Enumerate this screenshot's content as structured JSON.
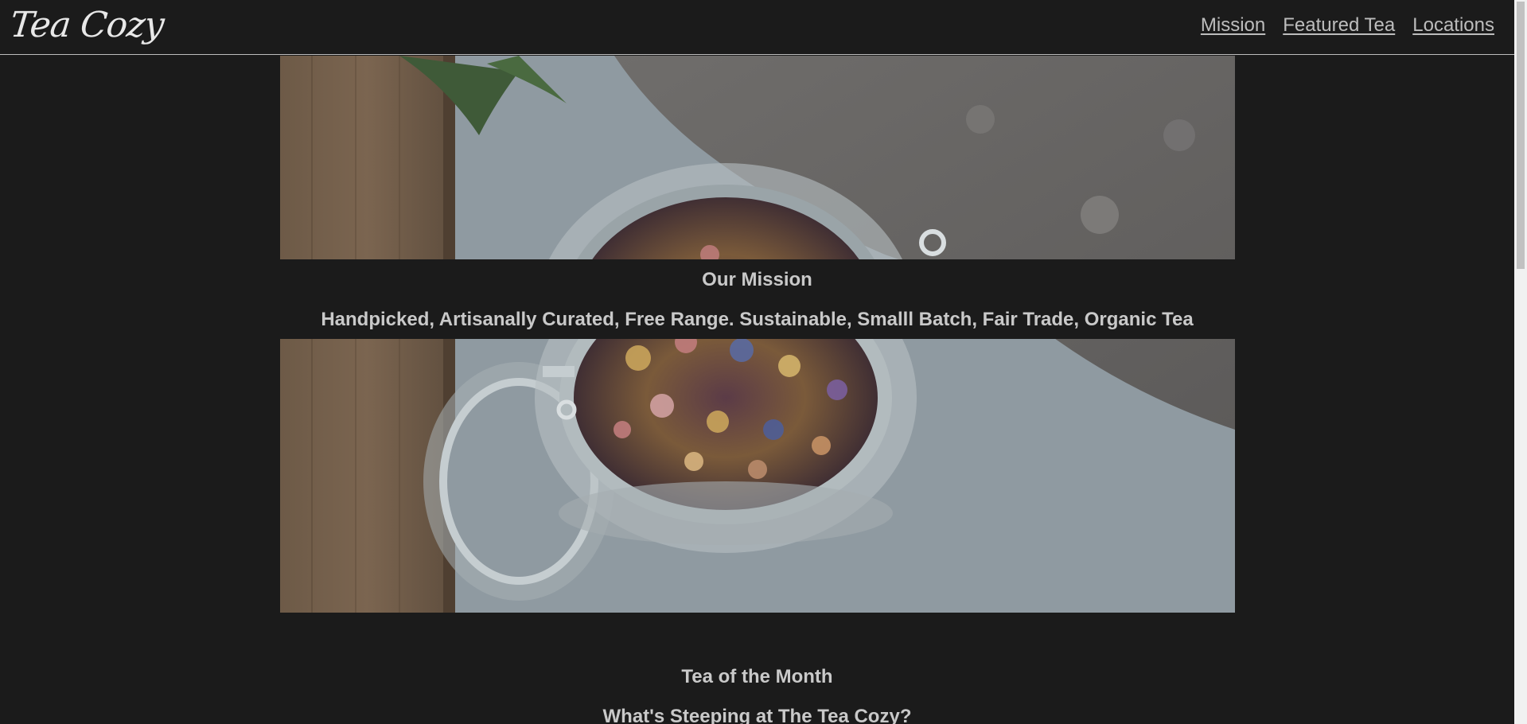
{
  "header": {
    "logo": "Tea Cozy",
    "nav": [
      {
        "label": "Mission"
      },
      {
        "label": "Featured Tea"
      },
      {
        "label": "Locations"
      }
    ]
  },
  "mission": {
    "title": "Our Mission",
    "text": "Handpicked, Artisanally Curated, Free Range. Sustainable, Smalll Batch, Fair Trade, Organic Tea"
  },
  "tea_of_month": {
    "title": "Tea of the Month",
    "subtitle": "What's Steeping at The Tea Cozy?"
  },
  "colors": {
    "background": "#1b1b1b",
    "text": "#c9c9c9",
    "header_border": "#bdbdbd"
  }
}
